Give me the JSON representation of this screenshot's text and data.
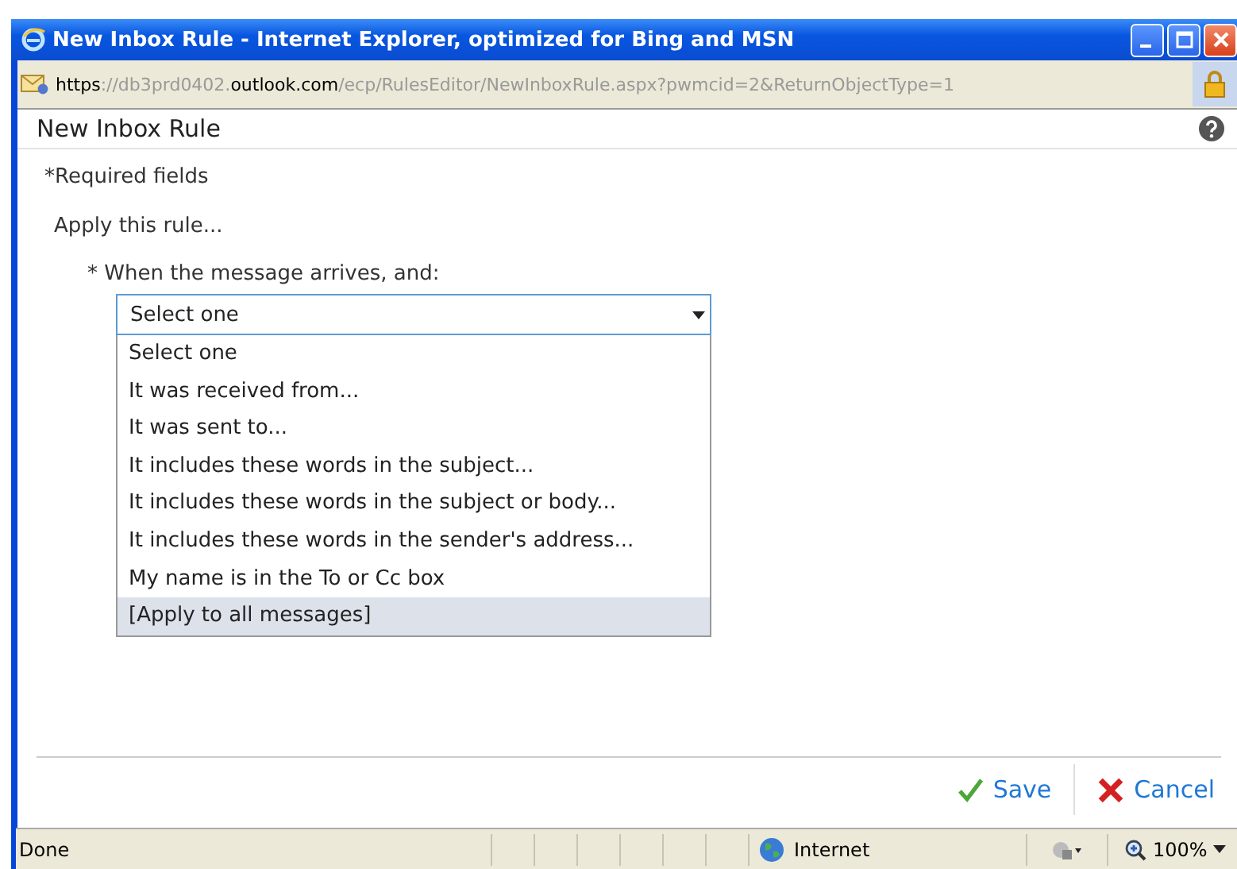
{
  "window": {
    "title": "New Inbox Rule - Internet Explorer, optimized for Bing and MSN"
  },
  "address": [
    {
      "text": "https",
      "kind": "strong"
    },
    {
      "text": "://db3prd0402.",
      "kind": "dim"
    },
    {
      "text": "outlook.com",
      "kind": "strong"
    },
    {
      "text": "/ecp/RulesEditor/NewInboxRule.aspx?pwmcid=2&ReturnObjectType=1",
      "kind": "dim"
    }
  ],
  "dialog": {
    "title": "New Inbox Rule",
    "required_note": "*Required fields",
    "section": "Apply this rule...",
    "condition_label": "* When the message arrives, and:",
    "select": {
      "value": "Select one",
      "expanded": true,
      "options": [
        {
          "label": "Select one",
          "highlighted": false
        },
        {
          "label": "It was received from...",
          "highlighted": false
        },
        {
          "label": "It was sent to...",
          "highlighted": false
        },
        {
          "label": "It includes these words in the subject...",
          "highlighted": false
        },
        {
          "label": "It includes these words in the subject or body...",
          "highlighted": false
        },
        {
          "label": "It includes these words in the sender's address...",
          "highlighted": false
        },
        {
          "label": "My name is in the To or Cc box",
          "highlighted": false
        },
        {
          "label": "[Apply to all messages]",
          "highlighted": true
        }
      ]
    }
  },
  "buttons": [
    {
      "label": "Save",
      "kind": "save"
    },
    {
      "label": "Cancel",
      "kind": "cancel"
    }
  ],
  "status_bar": {
    "status": "Done",
    "zone": "Internet",
    "zoom": "100%"
  }
}
